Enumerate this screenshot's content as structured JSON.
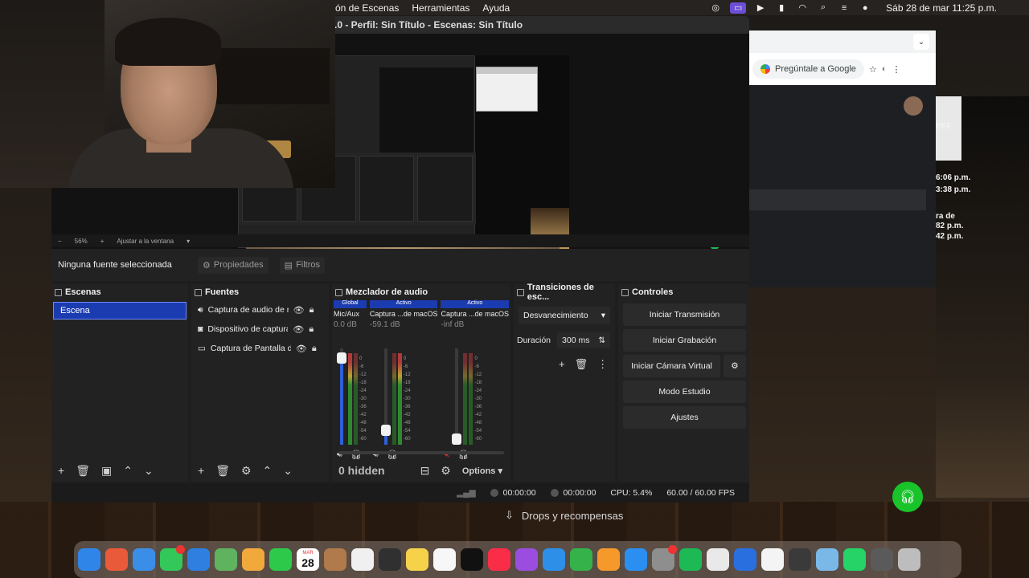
{
  "menubar": {
    "items": [
      "ón de Escenas",
      "Herramientas",
      "Ayuda"
    ],
    "clock": "Sáb 28 de mar  11:25 p.m."
  },
  "obs": {
    "title": ".0 - Perfil: Sin Título - Escenas: Sin Título",
    "zoom": {
      "percent": "56%",
      "fit_label": "Ajustar a la ventana"
    },
    "source_bar": {
      "none_selected": "Ninguna fuente seleccionada",
      "properties": "Propiedades",
      "filters": "Filtros"
    },
    "scenes": {
      "title": "Escenas",
      "items": [
        "Escena"
      ]
    },
    "sources": {
      "title": "Fuentes",
      "items": [
        {
          "name": "Captura de audio de n",
          "icon": "speaker-icon"
        },
        {
          "name": "Dispositivo de captura",
          "icon": "camera-icon"
        },
        {
          "name": "Captura de Pantalla de",
          "icon": "monitor-icon"
        }
      ]
    },
    "mixer": {
      "title": "Mezclador de audio",
      "channels": [
        {
          "badge": "Global",
          "name": "Mic/Aux",
          "db": "0.0 dB",
          "level": 0.9
        },
        {
          "badge": "Activo",
          "name": "Captura ...de macOS",
          "db": "-59.1 dB",
          "level": 0.15
        },
        {
          "badge": "Activo",
          "name": "Captura ...de macOS",
          "db": "-inf dB",
          "level": 0.0
        }
      ],
      "scale": [
        "0",
        "-6",
        "-12",
        "-18",
        "-24",
        "-30",
        "-36",
        "-42",
        "-48",
        "-54",
        "-60"
      ],
      "hidden_label": "0 hidden",
      "options_label": "Options"
    },
    "transitions": {
      "title": "Transiciones de esc...",
      "selected": "Desvanecimiento",
      "duration_label": "Duración",
      "duration_value": "300 ms"
    },
    "controls": {
      "title": "Controles",
      "start_stream": "Iniciar Transmisión",
      "start_record": "Iniciar Grabación",
      "start_vcam": "Iniciar Cámara Virtual",
      "studio_mode": "Modo Estudio",
      "settings": "Ajustes"
    },
    "status": {
      "stream_time": "00:00:00",
      "record_time": "00:00:00",
      "cpu": "CPU: 5.4%",
      "fps": "60.00 / 60.00 FPS"
    }
  },
  "chrome": {
    "omnibox": "Pregúntale a Google"
  },
  "drops_label": "Drops y recompensas",
  "right_fragments": [
    "PEF",
    "6:06 p.m.",
    "3:38 p.m.",
    "ra de",
    "82 p.m.",
    "42 p.m."
  ],
  "dock": {
    "calendar_month": "MAR",
    "calendar_day": "28",
    "apps": [
      {
        "name": "finder",
        "color": "#2f86e8"
      },
      {
        "name": "launchpad",
        "color": "#e85a3a"
      },
      {
        "name": "safari",
        "color": "#3a8ee8"
      },
      {
        "name": "messages",
        "color": "#34c759"
      },
      {
        "name": "mail",
        "color": "#2f7fe0"
      },
      {
        "name": "maps",
        "color": "#5fb35f"
      },
      {
        "name": "photos",
        "color": "#f2a93b"
      },
      {
        "name": "facetime",
        "color": "#2cc94a"
      },
      {
        "name": "calendar",
        "color": "#ffffff"
      },
      {
        "name": "contacts",
        "color": "#b07a4a"
      },
      {
        "name": "reminders",
        "color": "#f0f0f0"
      },
      {
        "name": "obs",
        "color": "#303030"
      },
      {
        "name": "notes",
        "color": "#f6d24a"
      },
      {
        "name": "freeform",
        "color": "#f7f7f7"
      },
      {
        "name": "apple-tv",
        "color": "#111111"
      },
      {
        "name": "music",
        "color": "#fa2d48"
      },
      {
        "name": "podcasts",
        "color": "#9b4de0"
      },
      {
        "name": "keynote",
        "color": "#2e8fe8"
      },
      {
        "name": "numbers",
        "color": "#35b34a"
      },
      {
        "name": "pages",
        "color": "#f59a2a"
      },
      {
        "name": "app-store",
        "color": "#2a8ff0"
      },
      {
        "name": "system-settings",
        "color": "#8e8e8e"
      },
      {
        "name": "spotify",
        "color": "#1db954"
      },
      {
        "name": "card-app",
        "color": "#e9e9e9"
      },
      {
        "name": "blue-app",
        "color": "#2a6fe0"
      },
      {
        "name": "chrome",
        "color": "#f4f4f4"
      },
      {
        "name": "obs-studio",
        "color": "#3a3a3a"
      },
      {
        "name": "mascot-app",
        "color": "#7ab8e8"
      },
      {
        "name": "whatsapp",
        "color": "#25d366"
      },
      {
        "name": "folder",
        "color": "#5a5a5a"
      },
      {
        "name": "trash",
        "color": "#bdbdbd"
      }
    ]
  }
}
